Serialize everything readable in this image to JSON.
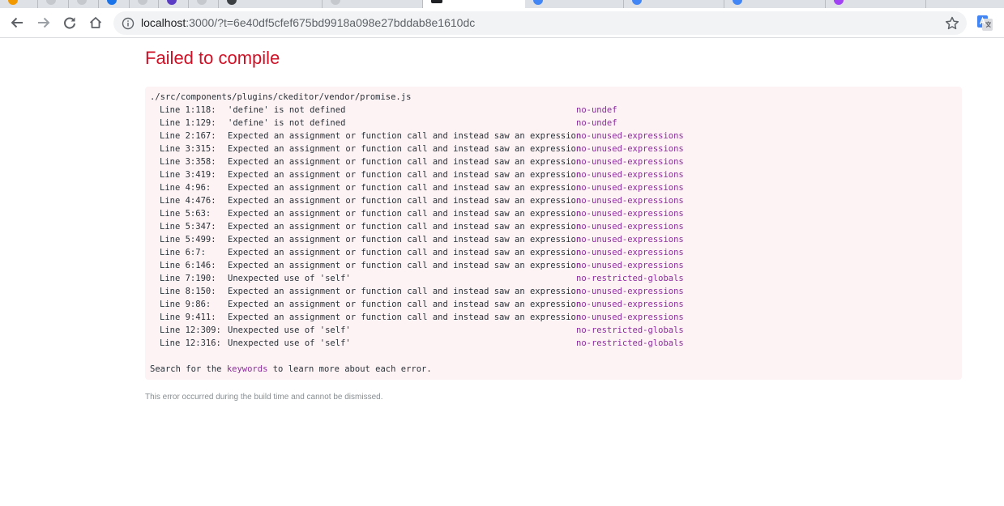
{
  "browser": {
    "url_host": "localhost",
    "url_rest": ":3000/?t=6e40df5cfef675bd9918a098e27bddab8e1610dc"
  },
  "overlay": {
    "title": "Failed to compile",
    "file_path": "./src/components/plugins/ckeditor/vendor/promise.js",
    "errors": [
      {
        "loc": "Line 1:118:",
        "message": "'define' is not defined",
        "rule": "no-undef"
      },
      {
        "loc": "Line 1:129:",
        "message": "'define' is not defined",
        "rule": "no-undef"
      },
      {
        "loc": "Line 2:167:",
        "message": "Expected an assignment or function call and instead saw an expression",
        "rule": "no-unused-expressions"
      },
      {
        "loc": "Line 3:315:",
        "message": "Expected an assignment or function call and instead saw an expression",
        "rule": "no-unused-expressions"
      },
      {
        "loc": "Line 3:358:",
        "message": "Expected an assignment or function call and instead saw an expression",
        "rule": "no-unused-expressions"
      },
      {
        "loc": "Line 3:419:",
        "message": "Expected an assignment or function call and instead saw an expression",
        "rule": "no-unused-expressions"
      },
      {
        "loc": "Line 4:96:",
        "message": "Expected an assignment or function call and instead saw an expression",
        "rule": "no-unused-expressions"
      },
      {
        "loc": "Line 4:476:",
        "message": "Expected an assignment or function call and instead saw an expression",
        "rule": "no-unused-expressions"
      },
      {
        "loc": "Line 5:63:",
        "message": "Expected an assignment or function call and instead saw an expression",
        "rule": "no-unused-expressions"
      },
      {
        "loc": "Line 5:347:",
        "message": "Expected an assignment or function call and instead saw an expression",
        "rule": "no-unused-expressions"
      },
      {
        "loc": "Line 5:499:",
        "message": "Expected an assignment or function call and instead saw an expression",
        "rule": "no-unused-expressions"
      },
      {
        "loc": "Line 6:7:",
        "message": "Expected an assignment or function call and instead saw an expression",
        "rule": "no-unused-expressions"
      },
      {
        "loc": "Line 6:146:",
        "message": "Expected an assignment or function call and instead saw an expression",
        "rule": "no-unused-expressions"
      },
      {
        "loc": "Line 7:190:",
        "message": "Unexpected use of 'self'",
        "rule": "no-restricted-globals"
      },
      {
        "loc": "Line 8:150:",
        "message": "Expected an assignment or function call and instead saw an expression",
        "rule": "no-unused-expressions"
      },
      {
        "loc": "Line 9:86:",
        "message": "Expected an assignment or function call and instead saw an expression",
        "rule": "no-unused-expressions"
      },
      {
        "loc": "Line 9:411:",
        "message": "Expected an assignment or function call and instead saw an expression",
        "rule": "no-unused-expressions"
      },
      {
        "loc": "Line 12:309:",
        "message": "Unexpected use of 'self'",
        "rule": "no-restricted-globals"
      },
      {
        "loc": "Line 12:316:",
        "message": "Unexpected use of 'self'",
        "rule": "no-restricted-globals"
      }
    ],
    "search_prefix": "Search for the ",
    "search_link": "keywords",
    "search_suffix": " to learn more about each error.",
    "note": "This error occurred during the build time and cannot be dismissed."
  },
  "colors": {
    "title_red": "#ce1126",
    "error_bg": "#fdf2f4",
    "rule_purple": "#8e2b9f",
    "note_gray": "#878e91"
  },
  "icons": {
    "back": "arrow-left",
    "forward": "arrow-right",
    "reload": "reload",
    "home": "home",
    "site_info": "info-circle",
    "bookmark": "star",
    "extension": "google-translate"
  }
}
